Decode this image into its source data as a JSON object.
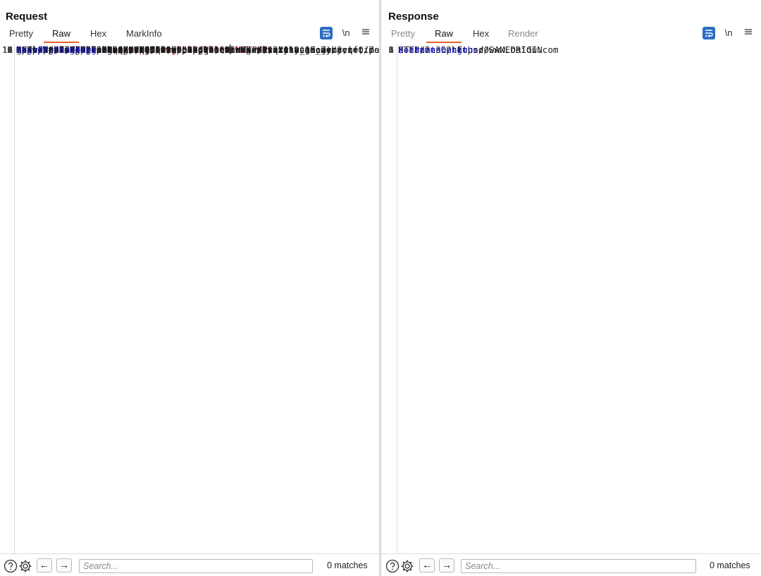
{
  "request": {
    "title": "Request",
    "tabs": [
      {
        "label": "Pretty",
        "active": false
      },
      {
        "label": "Raw",
        "active": true
      },
      {
        "label": "Hex",
        "active": false
      },
      {
        "label": "MarkInfo",
        "active": false
      }
    ],
    "newline_label": "\\n",
    "lines": [
      {
        "n": "1",
        "current": true,
        "parts": [
          [
            "t",
            "GET /post/next?"
          ],
          [
            "pk",
            "path"
          ],
          [
            "t",
            "="
          ],
          [
            "pv",
            "http://www.baidu.com"
          ],
          [
            "caret",
            ""
          ],
          [
            "t",
            " HTTP/2"
          ]
        ]
      },
      {
        "n": "2",
        "parts": [
          [
            "hn",
            "Host"
          ],
          [
            "t",
            ": 0afe0078038c83d980db0d2300410081.web-security-academy.net"
          ]
        ]
      },
      {
        "n": "3",
        "parts": [
          [
            "hn",
            "Cookie"
          ],
          [
            "t",
            ": "
          ],
          [
            "pk",
            "session"
          ],
          [
            "t",
            "="
          ],
          [
            "pv",
            "UMqvCwTryUbJ4g7LDVgWsbQVuMVRnFHv"
          ]
        ]
      },
      {
        "n": "4",
        "parts": [
          [
            "hn",
            "Sec-Ch-Ua"
          ],
          [
            "t",
            ": \"Chromium\";v=\"112\", \"Google Chrome\";v=\"112\","
          ]
        ]
      },
      {
        "n": "",
        "parts": [
          [
            "t",
            "\"Not:A-Brand\";v=\"99\""
          ]
        ]
      },
      {
        "n": "5",
        "parts": [
          [
            "hn",
            "Sec-Ch-Ua-Mobile"
          ],
          [
            "t",
            ": ?0"
          ]
        ]
      },
      {
        "n": "6",
        "parts": [
          [
            "hn",
            "Sec-Ch-Ua-Platform"
          ],
          [
            "t",
            ": \"macOS\""
          ]
        ]
      },
      {
        "n": "7",
        "parts": [
          [
            "hn",
            "Upgrade-Insecure-Requests"
          ],
          [
            "t",
            ": 1"
          ]
        ]
      },
      {
        "n": "8",
        "parts": [
          [
            "hn",
            "Dnt"
          ],
          [
            "t",
            ": 1"
          ]
        ]
      },
      {
        "n": "9",
        "parts": [
          [
            "hn",
            "User-Agent"
          ],
          [
            "t",
            ": Mozilla/5.0 (Macintosh; Intel Mac OS X 10_15_7)"
          ]
        ]
      },
      {
        "n": "",
        "parts": [
          [
            "t",
            "AppleWebKit/537.36 (KHTML, like Gecko) Chrome/112.0.0.0"
          ]
        ]
      },
      {
        "n": "",
        "parts": [
          [
            "t",
            "Safari/537.36"
          ]
        ]
      },
      {
        "n": "10",
        "parts": [
          [
            "hn",
            "Accept"
          ],
          [
            "t",
            ":"
          ]
        ]
      },
      {
        "n": "",
        "parts": [
          [
            "t",
            "text/html,application/xhtml+xml,application/xml;q=0.9,image/avif,ima"
          ]
        ]
      },
      {
        "n": "",
        "parts": [
          [
            "t",
            "ge/webp,image/apng,*/*;q=0.8,application/signed-exchange;v=b3;q=0.7"
          ]
        ]
      },
      {
        "n": "11",
        "parts": [
          [
            "hn",
            "Sec-Fetch-Site"
          ],
          [
            "t",
            ": same-origin"
          ]
        ]
      },
      {
        "n": "12",
        "parts": [
          [
            "hn",
            "Sec-Fetch-Mode"
          ],
          [
            "t",
            ": navigate"
          ]
        ]
      },
      {
        "n": "13",
        "parts": [
          [
            "hn",
            "Sec-Fetch-User"
          ],
          [
            "t",
            ": ?1"
          ]
        ]
      },
      {
        "n": "14",
        "parts": [
          [
            "hn",
            "Sec-Fetch-Dest"
          ],
          [
            "t",
            ": document"
          ]
        ]
      },
      {
        "n": "15",
        "parts": [
          [
            "hn",
            "Referer"
          ],
          [
            "t",
            ":"
          ]
        ]
      },
      {
        "n": "",
        "parts": [
          [
            "t",
            "https://0afe0078038c83d980db0d2300410081.web-security-academy.net/po"
          ]
        ]
      },
      {
        "n": "",
        "parts": [
          [
            "t",
            "st?postId=7"
          ]
        ]
      },
      {
        "n": "16",
        "parts": [
          [
            "hn",
            "Accept-Encoding"
          ],
          [
            "t",
            ": gzip, deflate"
          ]
        ]
      },
      {
        "n": "17",
        "parts": [
          [
            "hn",
            "Accept-Language"
          ],
          [
            "t",
            ": zh-CN,zh;q=0.9,en;q=0.8"
          ]
        ]
      },
      {
        "n": "18",
        "parts": []
      },
      {
        "n": "19",
        "parts": []
      }
    ],
    "search": {
      "placeholder": "Search...",
      "value": ""
    },
    "matches": "0 matches"
  },
  "response": {
    "title": "Response",
    "tabs": [
      {
        "label": "Pretty",
        "active": false
      },
      {
        "label": "Raw",
        "active": true
      },
      {
        "label": "Hex",
        "active": false
      },
      {
        "label": "Render",
        "active": false
      }
    ],
    "newline_label": "\\n",
    "lines": [
      {
        "n": "1",
        "current": true,
        "parts": [
          [
            "t",
            "HTTP/2 302 Found"
          ]
        ]
      },
      {
        "n": "2",
        "parts": [
          [
            "hn",
            "Location"
          ],
          [
            "t",
            ": http://www.baidu.com"
          ]
        ]
      },
      {
        "n": "3",
        "parts": [
          [
            "hn",
            "X-Frame-Options"
          ],
          [
            "t",
            ": SAMEORIGIN"
          ]
        ]
      },
      {
        "n": "4",
        "parts": [
          [
            "hn",
            "Content-Length"
          ],
          [
            "t",
            ": 0"
          ]
        ]
      },
      {
        "n": "5",
        "parts": []
      },
      {
        "n": "6",
        "parts": []
      }
    ],
    "search": {
      "placeholder": "Search...",
      "value": ""
    },
    "matches": "0 matches"
  },
  "colors": {
    "accent_tab": "#e8622c",
    "toggle_on": "#2b6cc4",
    "header_name": "#1c1ca8",
    "param_value": "#a3151a"
  },
  "icons": [
    "wrap-lines-icon",
    "menu-icon",
    "help-icon",
    "settings-icon",
    "arrow-left-icon",
    "arrow-right-icon",
    "layout-split-icon",
    "layout-horizontal-icon",
    "layout-single-icon"
  ]
}
